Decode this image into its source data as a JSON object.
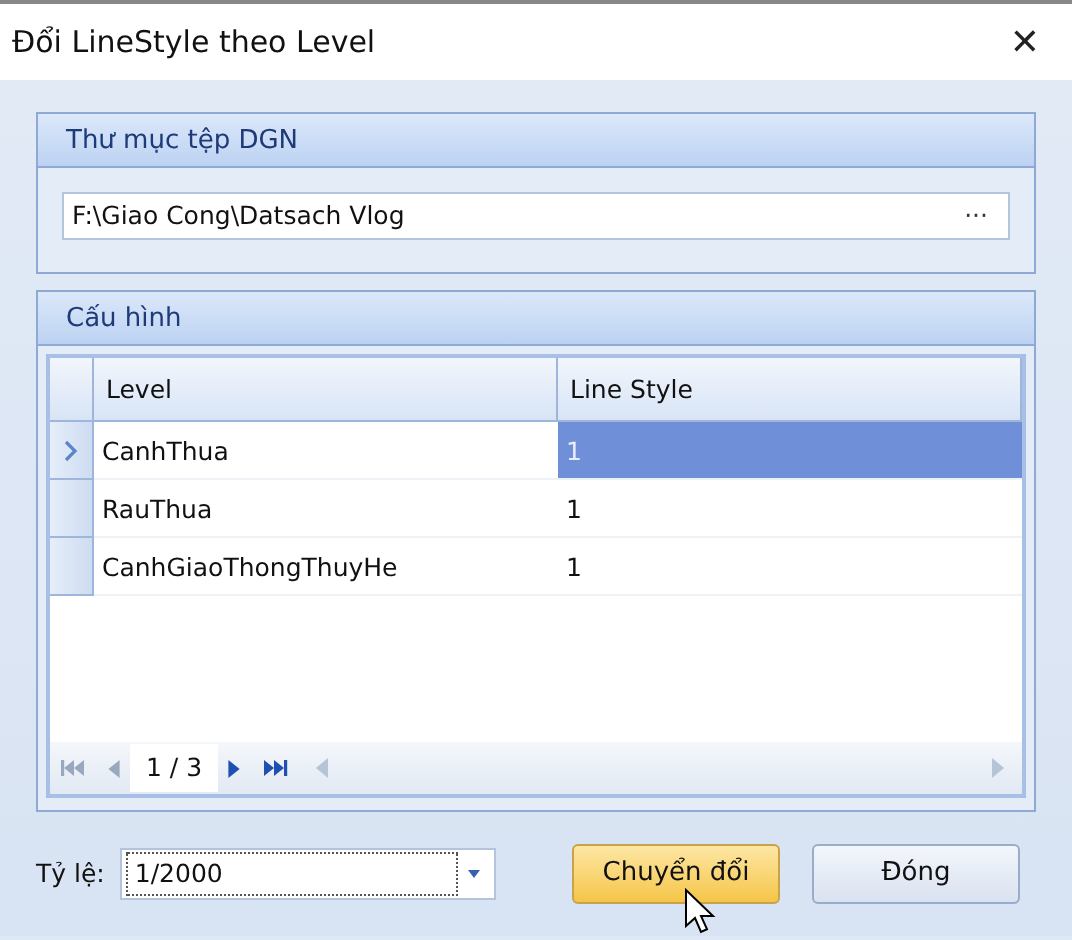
{
  "window": {
    "title": "Đổi LineStyle theo Level",
    "close": "✕"
  },
  "folder_group": {
    "title": "Thư mục tệp DGN",
    "path": "F:\\Giao Cong\\Datsach Vlog",
    "browse": "···"
  },
  "config_group": {
    "title": "Cấu hình",
    "columns": [
      "Level",
      "Line Style"
    ],
    "rows": [
      {
        "level": "CanhThua",
        "line_style": "1",
        "selected": true
      },
      {
        "level": "RauThua",
        "line_style": "1",
        "selected": false
      },
      {
        "level": "CanhGiaoThongThuyHe",
        "line_style": "1",
        "selected": false
      }
    ],
    "navigator": {
      "position": "1 / 3",
      "first_disabled": true,
      "prev_disabled": true,
      "next_disabled": false,
      "last_disabled": false
    }
  },
  "scale": {
    "label": "Tỷ lệ:",
    "value": "1/2000"
  },
  "buttons": [
    {
      "label": "Chuyển đổi",
      "hovered": true
    },
    {
      "label": "Đóng",
      "hovered": false
    }
  ]
}
